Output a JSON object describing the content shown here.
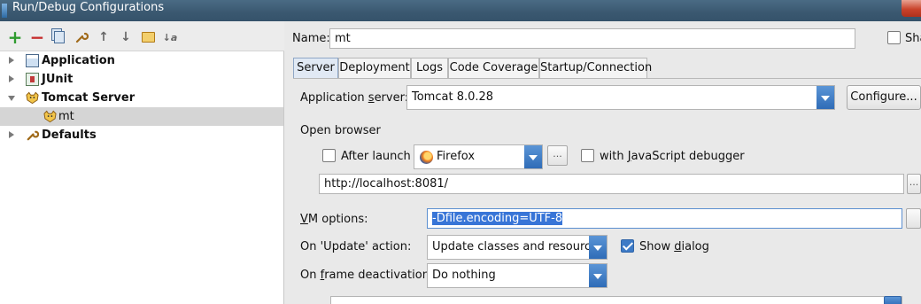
{
  "window": {
    "title": "Run/Debug Configurations"
  },
  "toolbar": {
    "add": "+",
    "remove": "−",
    "up": "↑",
    "down": "↓",
    "sort": "↓a"
  },
  "tree": [
    {
      "label": "Application",
      "expanded": false,
      "icon": "application-config-icon"
    },
    {
      "label": "JUnit",
      "expanded": false,
      "icon": "junit-icon"
    },
    {
      "label": "Tomcat Server",
      "expanded": true,
      "icon": "tomcat-icon"
    },
    {
      "label": "mt",
      "child": true,
      "selected": true,
      "icon": "tomcat-icon"
    },
    {
      "label": "Defaults",
      "expanded": false,
      "icon": "wrench-icon"
    }
  ],
  "name": {
    "label": "Name:",
    "value": "mt",
    "share_label": "Sha"
  },
  "tabs": [
    {
      "label": "Server",
      "active": true
    },
    {
      "label": "Deployment"
    },
    {
      "label": "Logs"
    },
    {
      "label": "Code Coverage"
    },
    {
      "label": "Startup/Connection"
    }
  ],
  "server": {
    "app_server_label": "Application server:",
    "app_server_value": "Tomcat 8.0.28",
    "configure_label": "Configure...",
    "open_browser_label": "Open browser",
    "after_launch_label": "After launch",
    "browser_value": "Firefox",
    "browser_more": "...",
    "js_debugger_label": "with JavaScript debugger",
    "url_value": "http://localhost:8081/",
    "url_more": "...",
    "vm_options_label": "VM options:",
    "vm_options_value": "-Dfile.encoding=UTF-8",
    "on_update_label": "On 'Update' action:",
    "on_update_value": "Update classes and resources",
    "show_dialog_label": "Show dialog",
    "on_frame_label": "On frame deactivation:",
    "on_frame_value": "Do nothing"
  },
  "colors": {
    "accent": "#2f6cb7",
    "selection": "#3875d7"
  }
}
